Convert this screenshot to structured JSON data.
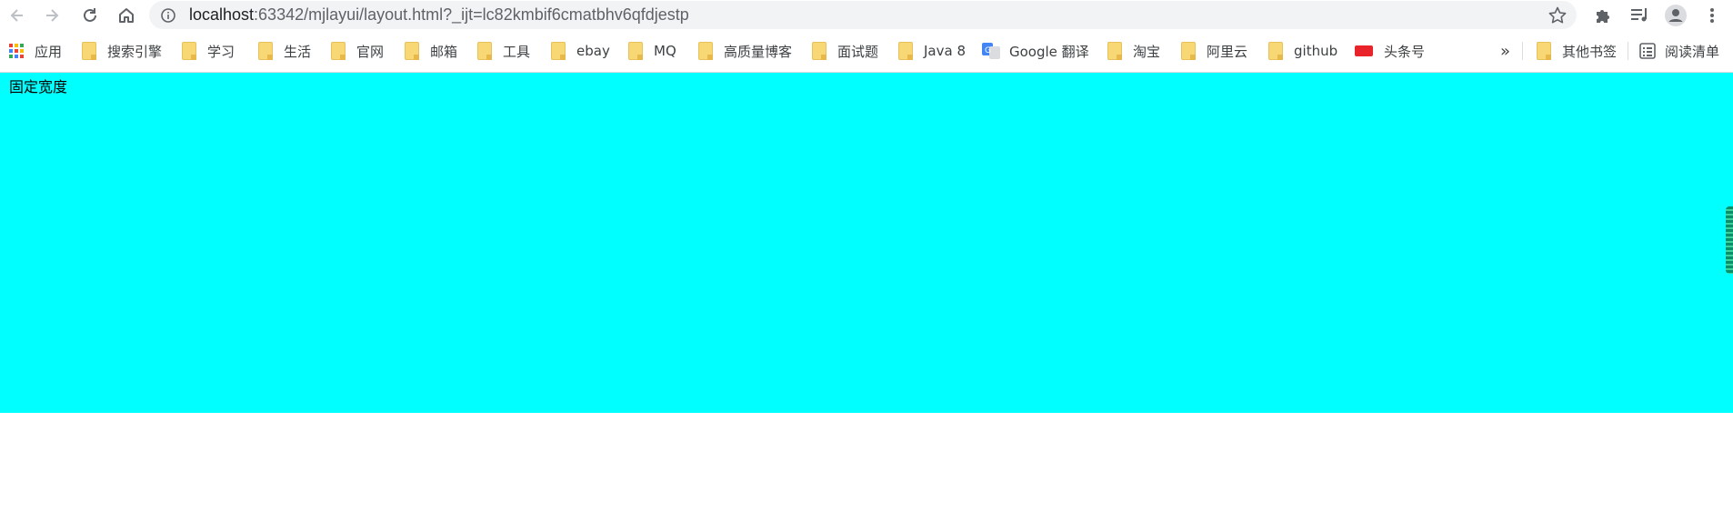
{
  "browser": {
    "url_host": "localhost",
    "url_rest": ":63342/mjlayui/layout.html?_ijt=lc82kmbif6cmatbhv6qfdjestp"
  },
  "bookmarks": {
    "apps": "应用",
    "items": [
      "搜索引擎",
      "学习",
      "生活",
      "官网",
      "邮箱",
      "工具",
      "ebay",
      "MQ",
      "高质量博客",
      "面试题",
      "Java 8"
    ],
    "google_translate": "Google 翻译",
    "items2": [
      "淘宝",
      "阿里云",
      "github"
    ],
    "toutiao": "头条号",
    "overflow": "»",
    "other": "其他书签",
    "reading_list": "阅读清单"
  },
  "page": {
    "label": "固定宽度",
    "background": "#00ffff"
  }
}
